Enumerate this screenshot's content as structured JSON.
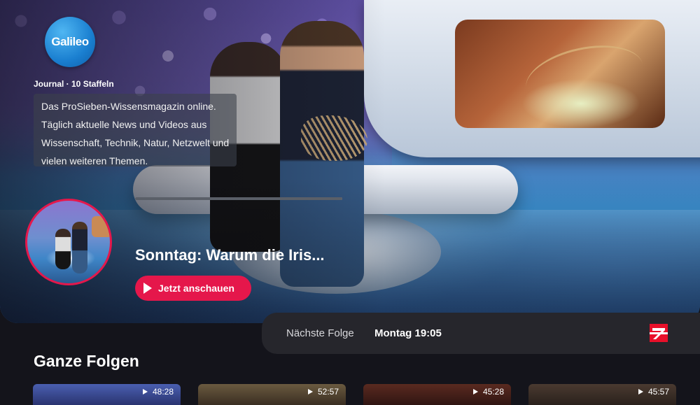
{
  "show": {
    "logo_text": "Galileo",
    "meta": "Journal · 10 Staffeln",
    "description": "Das ProSieben-Wissensmagazin online. Täglich aktuelle News und Videos aus Wissenschaft, Technik, Natur, Netzwelt und vielen weiteren Themen.",
    "progress_fraction": 1.0
  },
  "featured": {
    "episode_title": "Sonntag: Warum die Iris...",
    "watch_label": "Jetzt anschauen"
  },
  "next_episode": {
    "label": "Nächste Folge",
    "time": "Montag 19:05",
    "channel_logo": "prosieben-logo"
  },
  "section": {
    "title": "Ganze Folgen",
    "cards": [
      {
        "duration": "48:28"
      },
      {
        "duration": "52:57"
      },
      {
        "duration": "45:28"
      },
      {
        "duration": "45:57"
      }
    ]
  },
  "colors": {
    "accent": "#e5174b",
    "background": "#14141b",
    "next_bar": "#26262c",
    "logo_blue": "#1a7fd0"
  }
}
